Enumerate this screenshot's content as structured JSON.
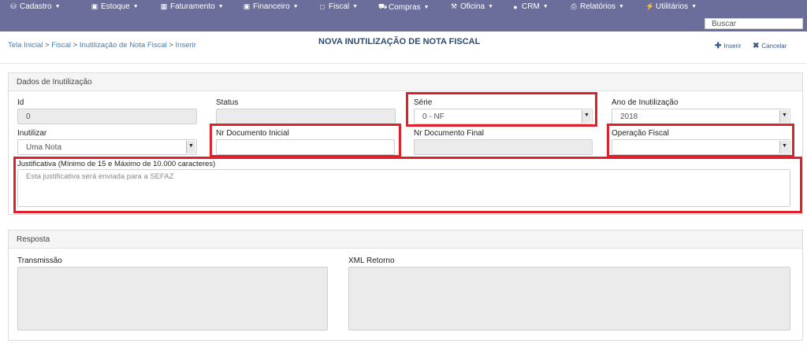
{
  "nav": {
    "items": [
      {
        "label": "Cadastro",
        "icon": "database-icon"
      },
      {
        "label": "Estoque",
        "icon": "cubes-icon"
      },
      {
        "label": "Faturamento",
        "icon": "calculator-icon"
      },
      {
        "label": "Financeiro",
        "icon": "money-icon"
      },
      {
        "label": "Fiscal",
        "icon": "file-icon"
      },
      {
        "label": "Compras",
        "icon": "truck-icon"
      },
      {
        "label": "Oficina",
        "icon": "wrench-icon"
      },
      {
        "label": "CRM",
        "icon": "users-icon"
      },
      {
        "label": "Relatórios",
        "icon": "print-icon"
      },
      {
        "label": "Utilitários",
        "icon": "bolt-icon"
      }
    ],
    "search_placeholder": "Buscar"
  },
  "header": {
    "breadcrumb": [
      "Tela Inicial",
      "Fiscal",
      "Inutilização de Nota Fiscal",
      "Inserir"
    ],
    "title": "NOVA INUTILIZAÇÃO DE NOTA FISCAL",
    "insert_label": "Inserir",
    "cancel_label": "Cancelar"
  },
  "form": {
    "panel_title": "Dados de Inutilização",
    "id": {
      "label": "Id",
      "value": "0"
    },
    "status": {
      "label": "Status",
      "value": ""
    },
    "serie": {
      "label": "Série",
      "value": "0 - NF"
    },
    "ano": {
      "label": "Ano de Inutilização",
      "value": "2018"
    },
    "inutilizar": {
      "label": "Inutilizar",
      "value": "Uma Nota"
    },
    "nr_inicial": {
      "label": "Nr Documento Inicial",
      "value": ""
    },
    "nr_final": {
      "label": "Nr Documento Final",
      "value": ""
    },
    "operacao": {
      "label": "Operação Fiscal",
      "value": ""
    },
    "justificativa": {
      "label": "Justificativa (Mínimo de 15 e Máximo de 10.000 caracteres)",
      "placeholder": "Esta justificativa será enviada para a SEFAZ"
    }
  },
  "resposta": {
    "panel_title": "Resposta",
    "transmissao_label": "Transmissão",
    "xml_label": "XML Retorno"
  },
  "colors": {
    "navbar": "#6b6e9b",
    "highlight": "#e0202a",
    "title": "#2b4b7a",
    "link": "#3b7fc4"
  }
}
